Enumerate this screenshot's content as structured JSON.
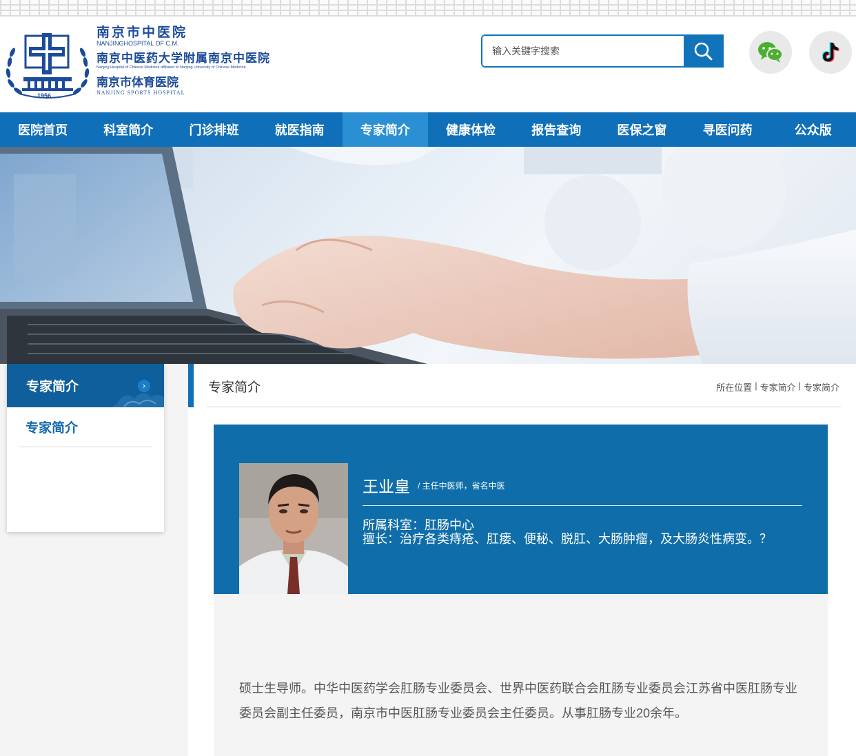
{
  "logo": {
    "line1": "南京市中医院",
    "en1": "NANJINGHOSPITAL OF C.M.",
    "line2": "南京中医药大学附属南京中医院",
    "en2": "Nanjing Hospital of Chinese Medicine affiliated to Nanjing University of Chinese Medicine",
    "line3": "南京市体育医院",
    "en3": "NANJING SPORTS HOSPITAL",
    "year": "1956",
    "brand_color": "#1b4b9a"
  },
  "search": {
    "placeholder": "输入关键字搜索",
    "icon": "search-icon"
  },
  "social": {
    "wechat_icon": "wechat-icon",
    "tiktok_icon": "tiktok-icon"
  },
  "nav": {
    "items": [
      {
        "label": "医院首页"
      },
      {
        "label": "科室简介"
      },
      {
        "label": "门诊排班"
      },
      {
        "label": "就医指南"
      },
      {
        "label": "专家简介",
        "active": true
      },
      {
        "label": "健康体检"
      },
      {
        "label": "报告查询"
      },
      {
        "label": "医保之窗"
      },
      {
        "label": "寻医问药"
      },
      {
        "label": "公众版"
      }
    ],
    "color": "#0f6fb8",
    "active_color": "#2b8fd3"
  },
  "sidebar": {
    "title": "专家简介",
    "items": [
      {
        "label": "专家简介"
      }
    ]
  },
  "main": {
    "title": "专家简介",
    "breadcrumb": [
      "所在位置",
      "|",
      "专家简介",
      "|",
      "专家简介"
    ]
  },
  "doctor": {
    "name": "王业皇",
    "title": "/ 主任中医师，省名中医",
    "dept": "所属科室：肛肠中心",
    "specialty": "擅长：治疗各类痔疮、肛瘘、便秘、脱肛、大肠肿瘤，及大肠炎性病变。？",
    "bio": "硕士生导师。中华中医药学会肛肠专业委员会、世界中医药联合会肛肠专业委员会江苏省中医肛肠专业委员会副主任委员，南京市中医肛肠专业委员会主任委员。从事肛肠专业20余年。",
    "card_color": "#0f6ea9"
  }
}
